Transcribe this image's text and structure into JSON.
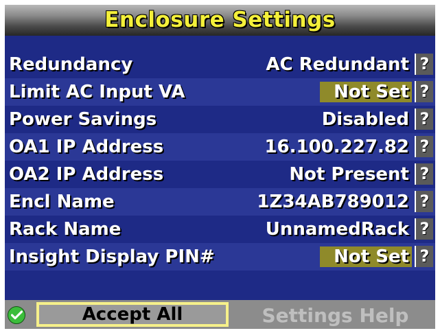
{
  "header": {
    "title": "Enclosure Settings"
  },
  "settings": [
    {
      "label": "Redundancy",
      "value": "AC Redundant",
      "highlight": false,
      "help": "?"
    },
    {
      "label": "Limit AC Input VA",
      "value": "Not Set",
      "highlight": true,
      "help": "?"
    },
    {
      "label": "Power Savings",
      "value": "Disabled",
      "highlight": false,
      "help": "?"
    },
    {
      "label": "OA1 IP Address",
      "value": "16.100.227.82",
      "highlight": false,
      "help": "?"
    },
    {
      "label": "OA2 IP Address",
      "value": "Not Present",
      "highlight": false,
      "help": "?"
    },
    {
      "label": "Encl Name",
      "value": "1Z34AB789012",
      "highlight": false,
      "help": "?"
    },
    {
      "label": "Rack Name",
      "value": "UnnamedRack",
      "highlight": false,
      "help": "?"
    },
    {
      "label": "Insight Display PIN#",
      "value": "Not Set",
      "highlight": true,
      "help": "?"
    }
  ],
  "footer": {
    "status_icon": "check-circle-icon",
    "accept_label": "Accept All",
    "help_label": "Settings Help"
  },
  "colors": {
    "title_text": "#f4f03a",
    "panel_bg": "#1e2a86",
    "highlight_bg": "#8f8a2a",
    "accept_border": "#f6f08a",
    "ok_green": "#3bbd3b"
  }
}
